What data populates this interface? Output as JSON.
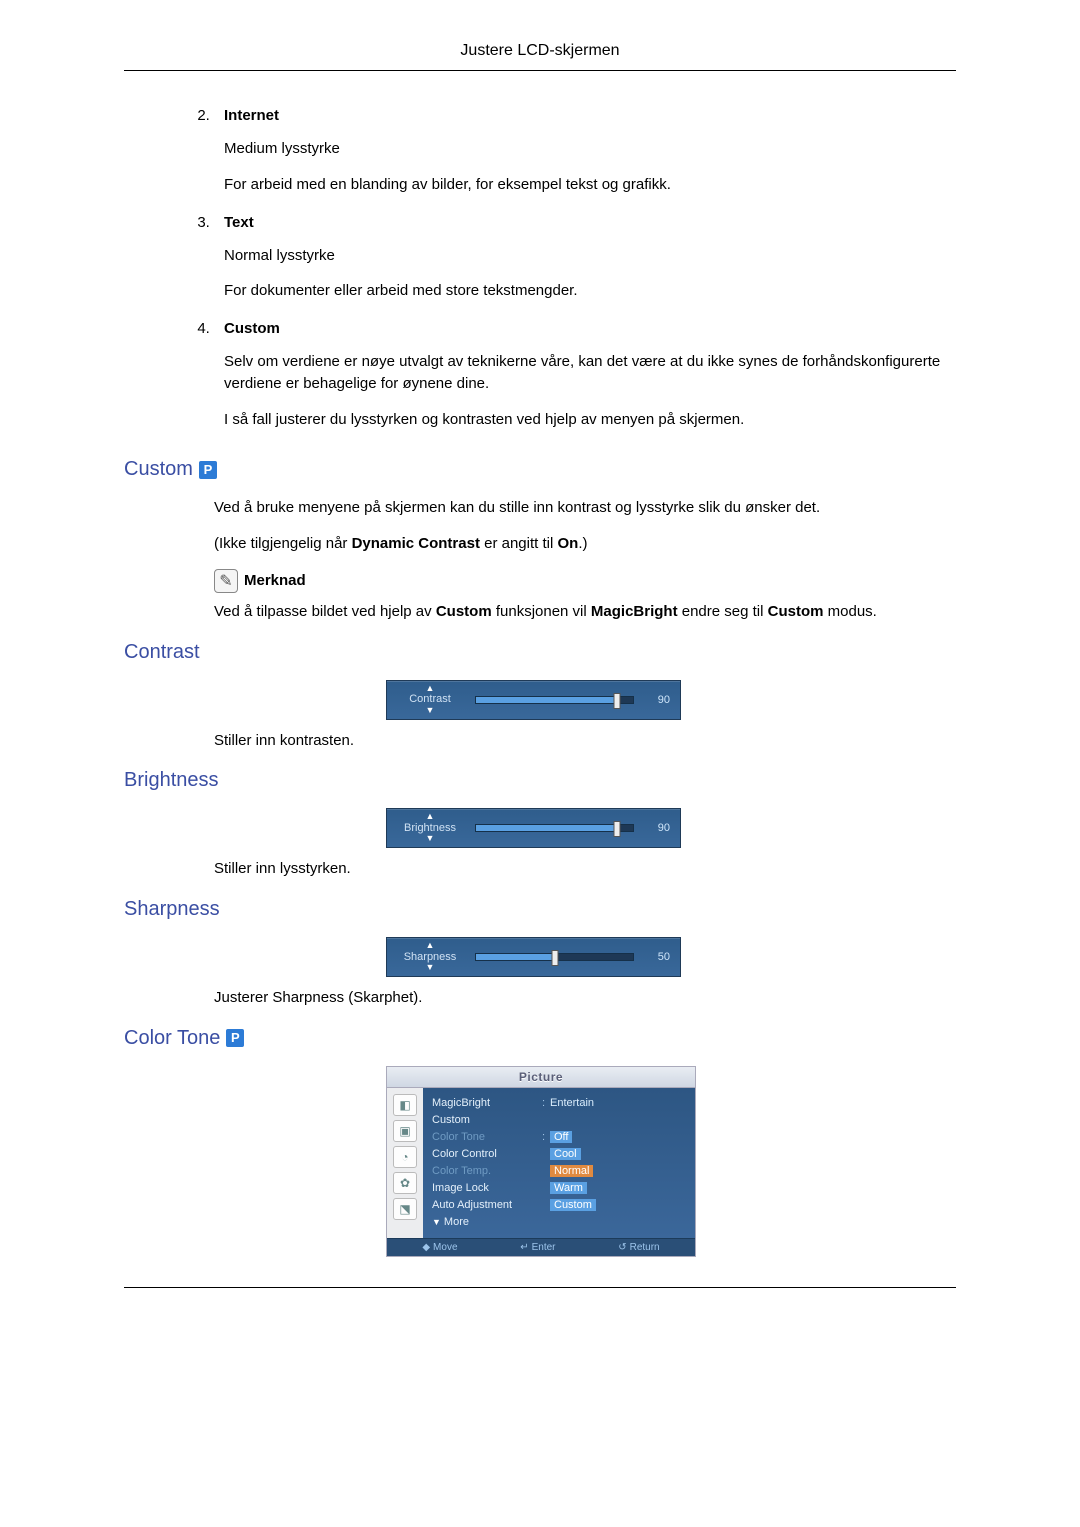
{
  "header": {
    "title": "Justere LCD-skjermen"
  },
  "list": {
    "start": 2,
    "items": [
      {
        "title": "Internet",
        "p1": "Medium lysstyrke",
        "p2": "For arbeid med en blanding av bilder, for eksempel tekst og grafikk."
      },
      {
        "title": "Text",
        "p1": "Normal lysstyrke",
        "p2": "For dokumenter eller arbeid med store tekstmengder."
      },
      {
        "title": "Custom",
        "p1": "Selv om verdiene er nøye utvalgt av teknikerne våre, kan det være at du ikke synes de forhåndskonfigurerte verdiene er behagelige for øynene dine.",
        "p2": "I så fall justerer du lysstyrken og kontrasten ved hjelp av menyen på skjermen."
      }
    ]
  },
  "custom": {
    "heading": "Custom",
    "badge": "P",
    "p1": "Ved å bruke menyene på skjermen kan du stille inn kontrast og lysstyrke slik du ønsker det.",
    "p2_pre": "(Ikke tilgjengelig når ",
    "p2_b1": "Dynamic Contrast",
    "p2_mid": " er angitt til ",
    "p2_b2": "On",
    "p2_post": ".)",
    "note_label": "Merknad",
    "p3_pre": "Ved å tilpasse bildet ved hjelp av ",
    "p3_b1": "Custom",
    "p3_mid1": " funksjonen vil ",
    "p3_b2": "MagicBright",
    "p3_mid2": " endre seg til ",
    "p3_b3": "Custom",
    "p3_post": " modus."
  },
  "contrast": {
    "heading": "Contrast",
    "slider_label": "Contrast",
    "value": 90,
    "desc": "Stiller inn kontrasten."
  },
  "brightness": {
    "heading": "Brightness",
    "slider_label": "Brightness",
    "value": 90,
    "desc": "Stiller inn lysstyrken."
  },
  "sharpness": {
    "heading": "Sharpness",
    "slider_label": "Sharpness",
    "value": 50,
    "desc": "Justerer Sharpness (Skarphet)."
  },
  "colortone": {
    "heading": "Color Tone",
    "badge": "P",
    "menu": {
      "title": "Picture",
      "rows": {
        "magicbright": {
          "k": "MagicBright",
          "v": "Entertain"
        },
        "custom": {
          "k": "Custom",
          "v": ""
        },
        "colortone": {
          "k": "Color Tone",
          "v": "Off"
        },
        "colorcontrol": {
          "k": "Color Control",
          "v": "Cool"
        },
        "colortemp": {
          "k": "Color Temp.",
          "v": "Normal"
        },
        "imagelock": {
          "k": "Image Lock",
          "v": "Warm"
        },
        "autoadj": {
          "k": "Auto Adjustment",
          "v": "Custom"
        },
        "more": {
          "k": "More",
          "v": ""
        }
      },
      "foot": {
        "move": "Move",
        "enter": "Enter",
        "ret": "Return"
      }
    }
  }
}
